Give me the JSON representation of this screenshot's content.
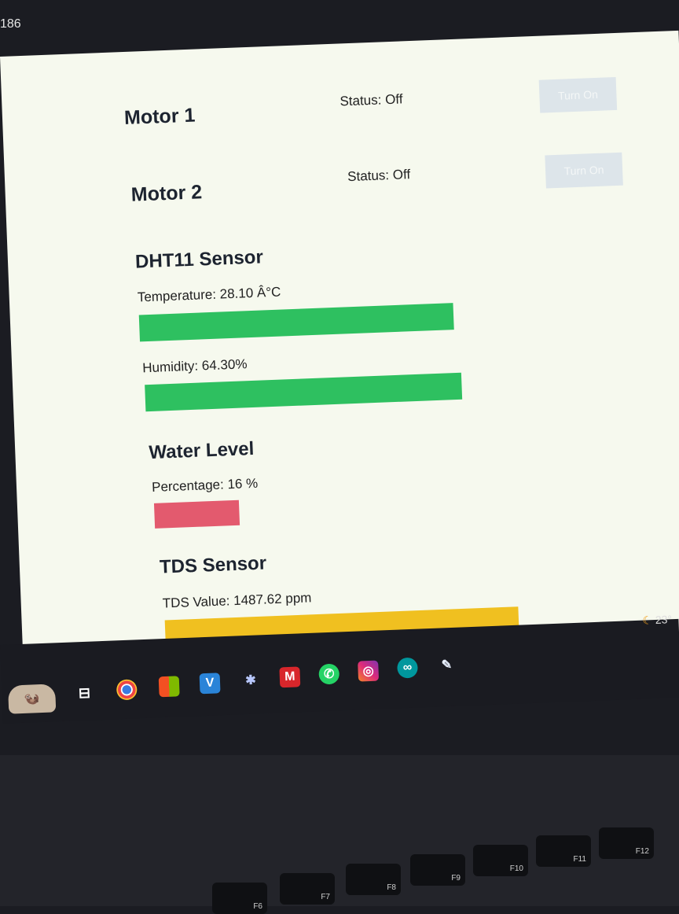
{
  "browser": {
    "corner_text": "186"
  },
  "motors": [
    {
      "title": "Motor 1",
      "status": "Status: Off",
      "button": "Turn On"
    },
    {
      "title": "Motor 2",
      "status": "Status: Off",
      "button": "Turn On"
    }
  ],
  "dht11": {
    "title": "DHT11 Sensor",
    "temperature_label": "Temperature: 28.10 Â°C",
    "temperature_value": 28.1,
    "humidity_label": "Humidity: 64.30%",
    "humidity_value": 64.3,
    "bar_color": "#2ec060"
  },
  "water_level": {
    "title": "Water Level",
    "percentage_label": "Percentage: 16 %",
    "percentage_value": 16,
    "bar_color": "#e35a6e"
  },
  "tds": {
    "title": "TDS Sensor",
    "value_label": "TDS Value: 1487.62 ppm",
    "value": 1487.62,
    "bar_color": "#f0c020"
  },
  "taskbar": {
    "weather": "23°",
    "apps": [
      "task-view-icon",
      "chrome-icon",
      "microsoft-store-icon",
      "vs-icon",
      "atom-icon",
      "mcafee-icon",
      "whatsapp-icon",
      "instagram-icon",
      "arduino-icon",
      "feather-icon"
    ]
  },
  "keyboard": {
    "keys": [
      "F6",
      "F7",
      "F8",
      "F9",
      "F10",
      "F11",
      "F12"
    ]
  }
}
